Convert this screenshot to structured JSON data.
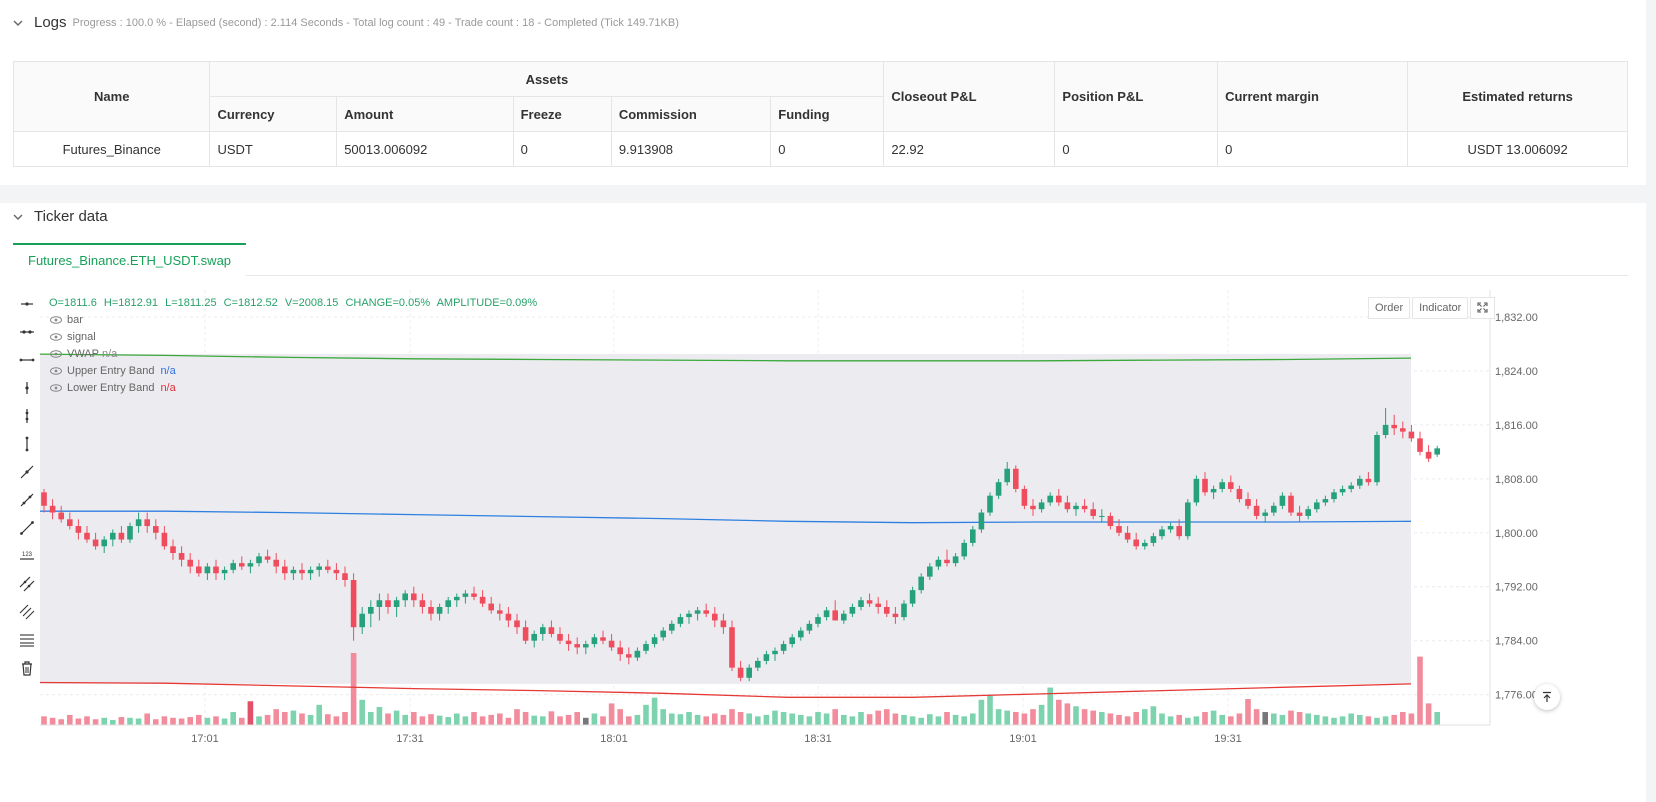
{
  "logs": {
    "title": "Logs",
    "meta": "Progress : 100.0 % - Elapsed (second) : 2.114  Seconds - Total log count : 49 - Trade count : 18 - Completed (Tick 149.71KB)"
  },
  "assets_table": {
    "headers": {
      "name": "Name",
      "assets": "Assets",
      "currency": "Currency",
      "amount": "Amount",
      "freeze": "Freeze",
      "commission": "Commission",
      "funding": "Funding",
      "closeout_pl": "Closeout P&L",
      "position_pl": "Position P&L",
      "current_margin": "Current margin",
      "estimated_returns": "Estimated returns"
    },
    "row": {
      "name": "Futures_Binance",
      "currency": "USDT",
      "amount": "50013.006092",
      "freeze": "0",
      "commission": "9.913908",
      "funding": "0",
      "closeout_pl": "22.92",
      "position_pl": "0",
      "current_margin": "0",
      "estimated_returns": "USDT 13.006092"
    }
  },
  "ticker": {
    "title": "Ticker data",
    "tab": "Futures_Binance.ETH_USDT.swap"
  },
  "chart_header": {
    "o": "O=1811.6",
    "h": "H=1812.91",
    "l": "L=1811.25",
    "c": "C=1812.52",
    "v": "V=2008.15",
    "change": "CHANGE=0.05%",
    "amplitude": "AMPLITUDE=0.09%"
  },
  "legend": {
    "bar": "bar",
    "signal": "signal",
    "vwap": "VWAP",
    "vwap_val": "n/a",
    "upper": "Upper Entry Band",
    "upper_val": "n/a",
    "lower": "Lower Entry Band",
    "lower_val": "n/a"
  },
  "chart_buttons": {
    "order": "Order",
    "indicator": "Indicator"
  },
  "colors": {
    "up": "#26a17b",
    "down": "#ef4d5e",
    "vwap": "#2f7fe0",
    "upper_band": "#3aa83a",
    "lower_band": "#e53935",
    "band_fill": "#ececf0"
  },
  "chart_data": {
    "type": "candlestick",
    "y_ticks": [
      "1,832.00",
      "1,824.00",
      "1,816.00",
      "1,808.00",
      "1,800.00",
      "1,792.00",
      "1,784.00",
      "1,776.00"
    ],
    "y_range": [
      1771.5,
      1836
    ],
    "x_ticks": [
      "17:01",
      "17:31",
      "18:01",
      "18:31",
      "19:01",
      "19:31"
    ],
    "upper_band": [
      1826.5,
      1826.3,
      1826,
      1825.8,
      1825.7,
      1825.6,
      1825.5,
      1825.5,
      1825.5,
      1825.6,
      1825.7,
      1825.9
    ],
    "vwap": [
      1803.2,
      1803.2,
      1803,
      1802.7,
      1802.4,
      1802.1,
      1801.7,
      1801.5,
      1801.6,
      1801.6,
      1801.6,
      1801.7
    ],
    "lower_band": [
      1777.8,
      1777.7,
      1777.3,
      1776.9,
      1776.6,
      1776.2,
      1775.6,
      1775.6,
      1776.1,
      1776.6,
      1777.1,
      1777.6
    ],
    "candles": [
      [
        1806,
        1806.5,
        1803,
        1804
      ],
      [
        1804,
        1805,
        1802,
        1803
      ],
      [
        1803,
        1804,
        1801.5,
        1802
      ],
      [
        1802,
        1803,
        1800.5,
        1801
      ],
      [
        1801,
        1802,
        1799,
        1800
      ],
      [
        1800,
        1801,
        1798.5,
        1799
      ],
      [
        1799,
        1800,
        1797.5,
        1798
      ],
      [
        1798,
        1799.5,
        1797,
        1799
      ],
      [
        1799,
        1800.5,
        1798,
        1800
      ],
      [
        1800,
        1801,
        1798.5,
        1799
      ],
      [
        1799,
        1801.5,
        1798.5,
        1801
      ],
      [
        1801,
        1803,
        1800,
        1802
      ],
      [
        1802,
        1803,
        1800,
        1801
      ],
      [
        1801,
        1802,
        1799,
        1800
      ],
      [
        1800,
        1801,
        1797.5,
        1798
      ],
      [
        1798,
        1799,
        1796,
        1797
      ],
      [
        1797,
        1798,
        1795,
        1796
      ],
      [
        1796,
        1797,
        1794,
        1795
      ],
      [
        1795,
        1796,
        1793.5,
        1794
      ],
      [
        1794,
        1795.5,
        1793,
        1795
      ],
      [
        1795,
        1796,
        1793,
        1794
      ],
      [
        1794,
        1795,
        1793,
        1794.5
      ],
      [
        1794.5,
        1796,
        1794,
        1795.5
      ],
      [
        1795.5,
        1796.5,
        1794.5,
        1795
      ],
      [
        1795,
        1796,
        1794,
        1795.5
      ],
      [
        1795.5,
        1797,
        1795,
        1796.5
      ],
      [
        1796.5,
        1797.5,
        1795.5,
        1796
      ],
      [
        1796,
        1797,
        1794,
        1795
      ],
      [
        1795,
        1796,
        1793,
        1794
      ],
      [
        1794,
        1795,
        1793,
        1794.5
      ],
      [
        1794.5,
        1795.5,
        1793,
        1794
      ],
      [
        1794,
        1795,
        1793,
        1794.5
      ],
      [
        1794.5,
        1795.5,
        1793.5,
        1795
      ],
      [
        1795,
        1796,
        1794,
        1794.5
      ],
      [
        1794.5,
        1795.5,
        1793,
        1794
      ],
      [
        1794,
        1795,
        1792,
        1793
      ],
      [
        1793,
        1794,
        1784,
        1786
      ],
      [
        1786,
        1789,
        1785,
        1788
      ],
      [
        1788,
        1790,
        1786,
        1789
      ],
      [
        1789,
        1791,
        1787,
        1790
      ],
      [
        1790,
        1791,
        1788,
        1789
      ],
      [
        1789,
        1790.5,
        1787.5,
        1790
      ],
      [
        1790,
        1791.5,
        1789,
        1791
      ],
      [
        1791,
        1792,
        1789,
        1790
      ],
      [
        1790,
        1791,
        1788,
        1789
      ],
      [
        1789,
        1790,
        1787,
        1788
      ],
      [
        1788,
        1789.5,
        1787,
        1789
      ],
      [
        1789,
        1790.5,
        1788,
        1790
      ],
      [
        1790,
        1791,
        1789,
        1790.5
      ],
      [
        1790.5,
        1791.5,
        1789.5,
        1791
      ],
      [
        1791,
        1792,
        1790,
        1790.5
      ],
      [
        1790.5,
        1791.5,
        1789,
        1789.5
      ],
      [
        1789.5,
        1790.5,
        1788,
        1788.5
      ],
      [
        1788.5,
        1789.5,
        1787,
        1788
      ],
      [
        1788,
        1789,
        1786,
        1787
      ],
      [
        1787,
        1788,
        1785,
        1786
      ],
      [
        1786,
        1787,
        1783.5,
        1784
      ],
      [
        1784,
        1785.5,
        1783,
        1785
      ],
      [
        1785,
        1786.5,
        1784,
        1786
      ],
      [
        1786,
        1787,
        1784.5,
        1785
      ],
      [
        1785,
        1786,
        1783.5,
        1784
      ],
      [
        1784,
        1785,
        1782.5,
        1783.5
      ],
      [
        1783.5,
        1784.5,
        1782,
        1783
      ],
      [
        1783,
        1784,
        1782,
        1783.5
      ],
      [
        1783.5,
        1785,
        1783,
        1784.5
      ],
      [
        1784.5,
        1785.5,
        1783.5,
        1784
      ],
      [
        1784,
        1785,
        1782.5,
        1783
      ],
      [
        1783,
        1784,
        1781,
        1782
      ],
      [
        1782,
        1783,
        1780.5,
        1781.5
      ],
      [
        1781.5,
        1783,
        1781,
        1782.5
      ],
      [
        1782.5,
        1784,
        1782,
        1783.5
      ],
      [
        1783.5,
        1785,
        1783,
        1784.5
      ],
      [
        1784.5,
        1786,
        1784,
        1785.5
      ],
      [
        1785.5,
        1787,
        1785,
        1786.5
      ],
      [
        1786.5,
        1788,
        1786,
        1787.5
      ],
      [
        1787.5,
        1788.5,
        1786.5,
        1788
      ],
      [
        1788,
        1789,
        1787,
        1788.5
      ],
      [
        1788.5,
        1789.5,
        1787.5,
        1788
      ],
      [
        1788,
        1789,
        1786,
        1787
      ],
      [
        1787,
        1788,
        1785,
        1786
      ],
      [
        1786,
        1787,
        1779.5,
        1780
      ],
      [
        1780,
        1781,
        1778,
        1778.5
      ],
      [
        1778.5,
        1780.5,
        1778,
        1780
      ],
      [
        1780,
        1781.5,
        1779.5,
        1781
      ],
      [
        1781,
        1782.5,
        1780.5,
        1782
      ],
      [
        1782,
        1783,
        1781,
        1782.5
      ],
      [
        1782.5,
        1784,
        1782,
        1783.5
      ],
      [
        1783.5,
        1785,
        1783,
        1784.5
      ],
      [
        1784.5,
        1786,
        1784,
        1785.5
      ],
      [
        1785.5,
        1787,
        1785,
        1786.5
      ],
      [
        1786.5,
        1788,
        1786,
        1787.5
      ],
      [
        1787.5,
        1789,
        1787,
        1788.5
      ],
      [
        1788.5,
        1790,
        1787.5,
        1787
      ],
      [
        1787,
        1788.5,
        1786.5,
        1788
      ],
      [
        1788,
        1789.5,
        1787.5,
        1789
      ],
      [
        1789,
        1790.5,
        1788.5,
        1790
      ],
      [
        1790,
        1791,
        1789,
        1789.5
      ],
      [
        1789.5,
        1790.5,
        1788,
        1789
      ],
      [
        1789,
        1790,
        1787.5,
        1788
      ],
      [
        1788,
        1789,
        1786.5,
        1787.5
      ],
      [
        1787.5,
        1790,
        1787,
        1789.5
      ],
      [
        1789.5,
        1792,
        1789,
        1791.5
      ],
      [
        1791.5,
        1794,
        1791,
        1793.5
      ],
      [
        1793.5,
        1795.5,
        1793,
        1795
      ],
      [
        1795,
        1796.5,
        1794.5,
        1796
      ],
      [
        1796,
        1797.5,
        1795,
        1795.5
      ],
      [
        1795.5,
        1797,
        1795,
        1796.5
      ],
      [
        1796.5,
        1799,
        1796,
        1798.5
      ],
      [
        1798.5,
        1801,
        1798,
        1800.5
      ],
      [
        1800.5,
        1803.5,
        1800,
        1803
      ],
      [
        1803,
        1806,
        1802.5,
        1805.5
      ],
      [
        1805.5,
        1808,
        1805,
        1807.5
      ],
      [
        1807.5,
        1810.5,
        1807,
        1809.5
      ],
      [
        1809.5,
        1810,
        1806,
        1806.5
      ],
      [
        1806.5,
        1807,
        1803.5,
        1804
      ],
      [
        1804,
        1805,
        1802.5,
        1803.5
      ],
      [
        1803.5,
        1805,
        1803,
        1804.5
      ],
      [
        1804.5,
        1806,
        1804,
        1805.5
      ],
      [
        1805.5,
        1806.5,
        1804,
        1804.5
      ],
      [
        1804.5,
        1805.5,
        1803,
        1803.5
      ],
      [
        1803.5,
        1804.5,
        1802.5,
        1804
      ],
      [
        1804,
        1805,
        1803,
        1803.5
      ],
      [
        1803.5,
        1804.5,
        1802,
        1802.5
      ],
      [
        1802.5,
        1803.5,
        1801.5,
        1802.5
      ],
      [
        1802.5,
        1803,
        1800.5,
        1801
      ],
      [
        1801,
        1802,
        1799.5,
        1800
      ],
      [
        1800,
        1801,
        1798.5,
        1799
      ],
      [
        1799,
        1800,
        1797.5,
        1798
      ],
      [
        1798,
        1799,
        1797.5,
        1798.5
      ],
      [
        1798.5,
        1800,
        1798,
        1799.5
      ],
      [
        1799.5,
        1801,
        1799,
        1800.5
      ],
      [
        1800.5,
        1801.5,
        1800,
        1801
      ],
      [
        1801,
        1802,
        1799,
        1799.5
      ],
      [
        1799.5,
        1805,
        1799,
        1804.5
      ],
      [
        1804.5,
        1808.5,
        1804,
        1808
      ],
      [
        1808,
        1809,
        1805.5,
        1806
      ],
      [
        1806,
        1807,
        1805,
        1806.5
      ],
      [
        1806.5,
        1808,
        1806,
        1807.5
      ],
      [
        1807.5,
        1808.5,
        1806,
        1806.5
      ],
      [
        1806.5,
        1807,
        1804.5,
        1805
      ],
      [
        1805,
        1806,
        1803.5,
        1804
      ],
      [
        1804,
        1805,
        1802,
        1802.5
      ],
      [
        1802.5,
        1803.5,
        1801.5,
        1803
      ],
      [
        1803,
        1804.5,
        1802.5,
        1804
      ],
      [
        1804,
        1806,
        1803.5,
        1805.5
      ],
      [
        1805.5,
        1806,
        1802.5,
        1803
      ],
      [
        1803,
        1804,
        1801.5,
        1802.5
      ],
      [
        1802.5,
        1804,
        1802,
        1803.5
      ],
      [
        1803.5,
        1805,
        1803,
        1804.5
      ],
      [
        1804.5,
        1805.5,
        1804,
        1805
      ],
      [
        1805,
        1806.5,
        1804.5,
        1806
      ],
      [
        1806,
        1807,
        1805.5,
        1806.5
      ],
      [
        1806.5,
        1807.5,
        1806,
        1807
      ],
      [
        1807,
        1808.5,
        1806.5,
        1808
      ],
      [
        1808,
        1809,
        1807,
        1807.5
      ],
      [
        1807.5,
        1815,
        1807,
        1814.5
      ],
      [
        1814.5,
        1818.5,
        1814,
        1816
      ],
      [
        1816,
        1817.5,
        1814.5,
        1815.5
      ],
      [
        1815.5,
        1816.5,
        1814,
        1815
      ],
      [
        1815,
        1816,
        1813.5,
        1814
      ],
      [
        1814,
        1815,
        1811.5,
        1812
      ],
      [
        1812,
        1813,
        1810.5,
        1811
      ],
      [
        1811.6,
        1812.91,
        1811.25,
        1812.52
      ]
    ],
    "volumes_rel": [
      0.12,
      0.1,
      0.08,
      0.14,
      0.09,
      0.12,
      0.08,
      0.1,
      0.07,
      0.11,
      0.1,
      0.09,
      0.16,
      0.08,
      0.12,
      0.1,
      0.09,
      0.11,
      0.14,
      0.1,
      0.12,
      0.09,
      0.18,
      0.1,
      0.33,
      0.12,
      0.14,
      0.22,
      0.18,
      0.2,
      0.16,
      0.14,
      0.28,
      0.15,
      0.12,
      0.18,
      1.0,
      0.35,
      0.18,
      0.25,
      0.16,
      0.2,
      0.14,
      0.18,
      0.12,
      0.15,
      0.13,
      0.11,
      0.16,
      0.12,
      0.18,
      0.12,
      0.14,
      0.16,
      0.1,
      0.22,
      0.18,
      0.13,
      0.12,
      0.19,
      0.12,
      0.14,
      0.18,
      0.1,
      0.16,
      0.12,
      0.3,
      0.22,
      0.12,
      0.14,
      0.28,
      0.38,
      0.22,
      0.16,
      0.15,
      0.18,
      0.14,
      0.12,
      0.16,
      0.14,
      0.22,
      0.18,
      0.16,
      0.12,
      0.14,
      0.2,
      0.18,
      0.16,
      0.14,
      0.12,
      0.18,
      0.16,
      0.22,
      0.14,
      0.12,
      0.18,
      0.15,
      0.2,
      0.22,
      0.16,
      0.14,
      0.12,
      0.1,
      0.15,
      0.12,
      0.18,
      0.14,
      0.12,
      0.16,
      0.35,
      0.42,
      0.22,
      0.2,
      0.18,
      0.16,
      0.22,
      0.28,
      0.52,
      0.35,
      0.3,
      0.26,
      0.22,
      0.2,
      0.18,
      0.16,
      0.14,
      0.12,
      0.18,
      0.22,
      0.26,
      0.16,
      0.12,
      0.14,
      0.1,
      0.12,
      0.18,
      0.2,
      0.14,
      0.12,
      0.16,
      0.36,
      0.22,
      0.18,
      0.16,
      0.14,
      0.2,
      0.18,
      0.16,
      0.14,
      0.12,
      0.1,
      0.12,
      0.16,
      0.14,
      0.12,
      0.1,
      0.12,
      0.14,
      0.18,
      0.16,
      0.95,
      0.3,
      0.18,
      0.16,
      0.14,
      0.12,
      0.1,
      0.08
    ],
    "volume_special": {
      "24": "#e2506a",
      "63": "#777777",
      "142": "#777777"
    }
  }
}
